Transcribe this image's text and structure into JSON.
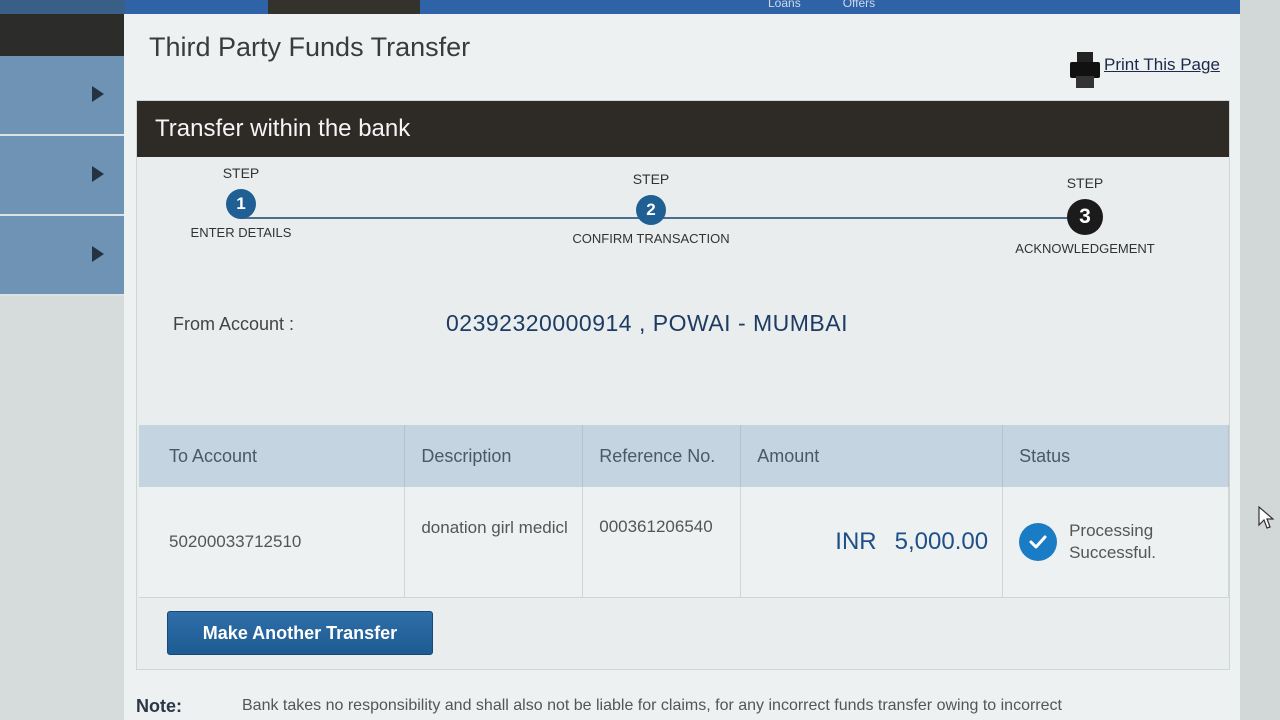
{
  "nav": {
    "items": [
      "",
      "",
      "",
      "",
      "Loans",
      "Offers"
    ]
  },
  "page": {
    "title": "Third Party Funds Transfer",
    "print_label": "Print This Page"
  },
  "card": {
    "header": "Transfer within the bank"
  },
  "steps": [
    {
      "word": "STEP",
      "number": "1",
      "label": "ENTER DETAILS"
    },
    {
      "word": "STEP",
      "number": "2",
      "label": "CONFIRM TRANSACTION"
    },
    {
      "word": "STEP",
      "number": "3",
      "label": "ACKNOWLEDGEMENT"
    }
  ],
  "from": {
    "label": "From Account :",
    "value": "02392320000914 , POWAI - MUMBAI"
  },
  "table": {
    "headers": [
      "To Account",
      "Description",
      "Reference No.",
      "Amount",
      "Status"
    ],
    "row": {
      "to_account": "50200033712510",
      "description": "donation girl medicl",
      "reference": "000361206540",
      "currency": "INR",
      "amount": "5,000.00",
      "status": "Processing Successful."
    }
  },
  "actions": {
    "make_another": "Make Another Transfer"
  },
  "note": {
    "label": "Note:",
    "text": "Bank takes no responsibility and shall also not be liable for claims, for any incorrect funds transfer owing to incorrect"
  },
  "colors": {
    "accent": "#1f5f93",
    "header_bg": "#2e2b27",
    "table_header_bg": "#c5d4e1",
    "success": "#1a7cc4"
  }
}
